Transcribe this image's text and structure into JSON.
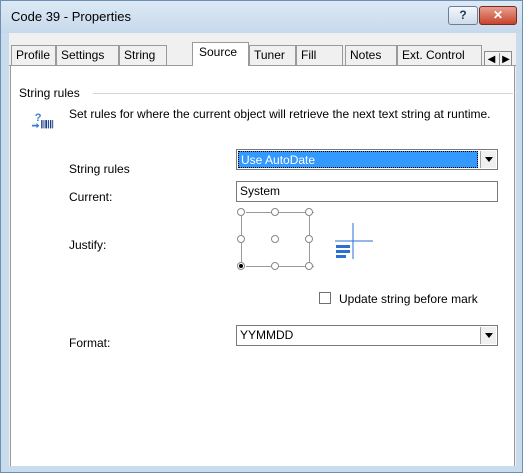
{
  "window": {
    "title": "Code 39 - Properties",
    "help_label": "?",
    "close_label": "✕"
  },
  "tabs": [
    {
      "label": "Profile",
      "active": false
    },
    {
      "label": "Settings",
      "active": false
    },
    {
      "label": "String",
      "active": false
    },
    {
      "label": "Source",
      "active": true
    },
    {
      "label": "Tuner",
      "active": false
    },
    {
      "label": "Fill",
      "active": false
    },
    {
      "label": "Notes",
      "active": false
    },
    {
      "label": "Ext. Control",
      "active": false
    }
  ],
  "tab_scroll": {
    "left": "◀",
    "right": "▶"
  },
  "group": {
    "title": "String rules",
    "icon": "barcode-rules-icon",
    "description": "Set rules for where the current object will retrieve the next text string at runtime."
  },
  "fields": {
    "string_rules": {
      "label": "String rules",
      "value": "Use AutoDate"
    },
    "current": {
      "label": "Current:",
      "value": "System"
    },
    "justify": {
      "label": "Justify:",
      "selected": "bottom-left"
    },
    "update_before_mark": {
      "label": "Update string before mark",
      "checked": false
    },
    "format": {
      "label": "Format:",
      "value": "YYMMDD"
    }
  },
  "colors": {
    "selection": "#3399ff",
    "titlebar": "#c9dced",
    "close_button": "#c8442c"
  }
}
